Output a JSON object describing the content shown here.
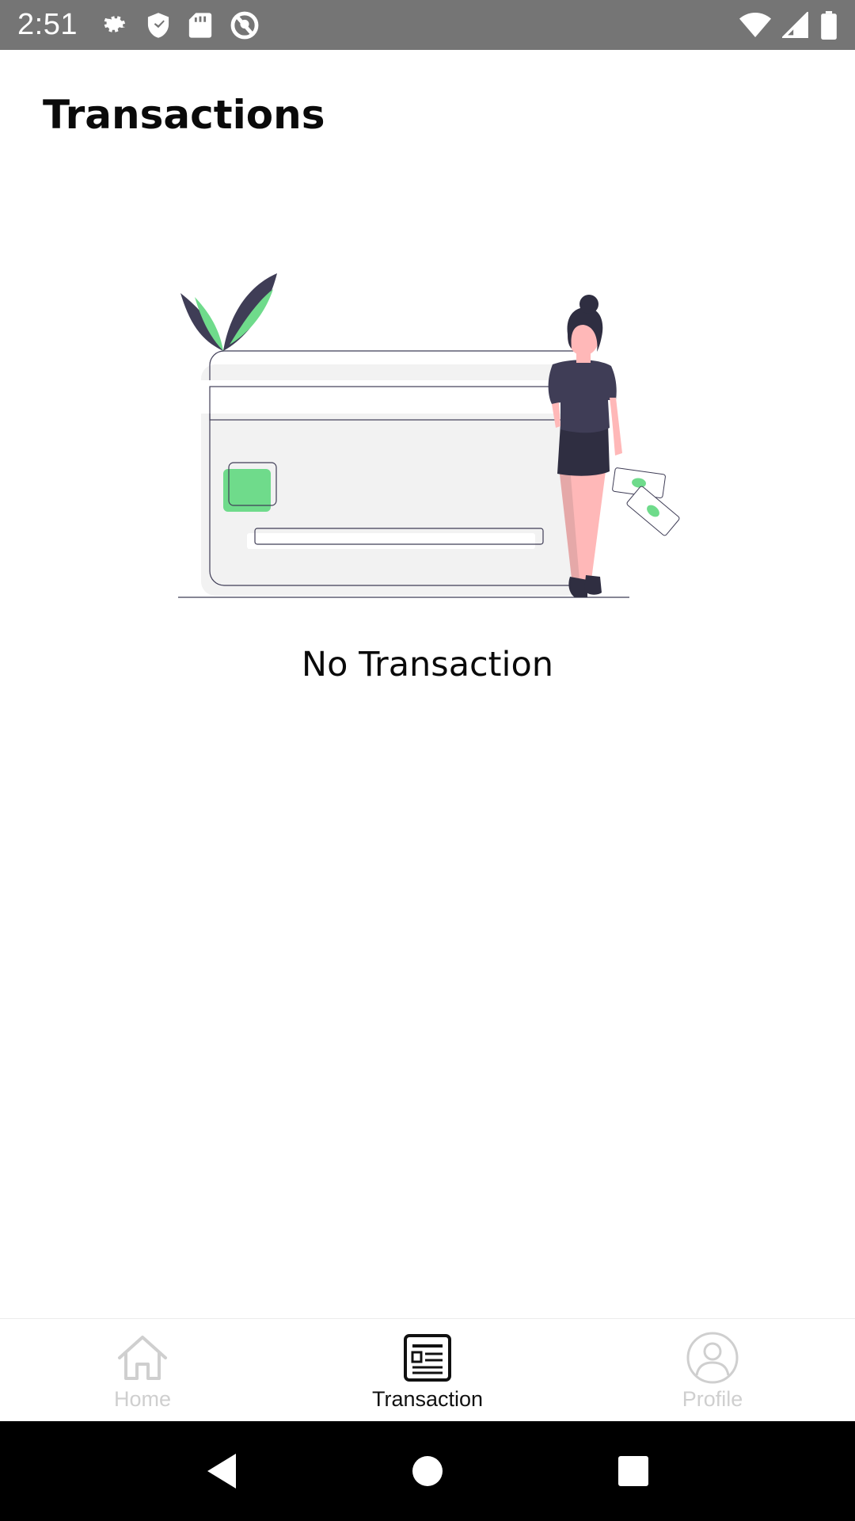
{
  "status_bar": {
    "time": "2:51",
    "left_icons": [
      "gear-icon",
      "shield-icon",
      "sd-card-icon",
      "no-location-icon"
    ],
    "right_icons": [
      "wifi-icon",
      "signal-icon",
      "battery-icon"
    ]
  },
  "header": {
    "title": "Transactions"
  },
  "empty_state": {
    "message": "No Transaction",
    "illustration": "credit-card-woman-illustration"
  },
  "bottom_nav": {
    "items": [
      {
        "label": "Home",
        "icon": "home-icon",
        "active": false
      },
      {
        "label": "Transaction",
        "icon": "receipt-icon",
        "active": true
      },
      {
        "label": "Profile",
        "icon": "profile-icon",
        "active": false
      }
    ]
  },
  "system_nav": {
    "buttons": [
      "back-icon",
      "home-circle-icon",
      "recents-icon"
    ]
  },
  "colors": {
    "status_bar_bg": "#757575",
    "accent_green": "#6fdb8b",
    "dark_purple": "#3f3d56",
    "skin": "#ffb8b8",
    "inactive_nav": "#cfcfcf",
    "active_nav": "#111111"
  }
}
